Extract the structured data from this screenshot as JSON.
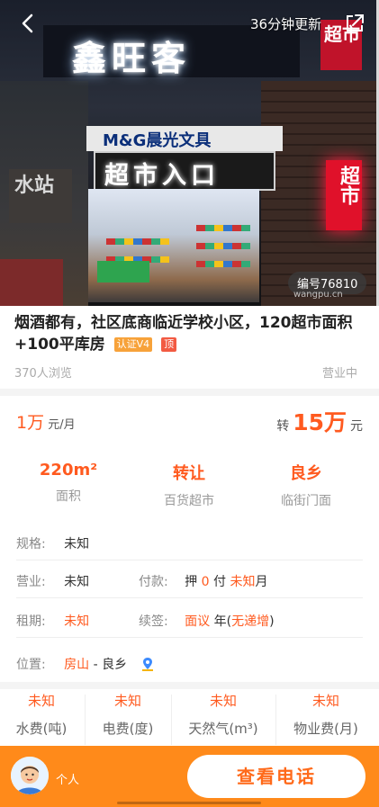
{
  "header": {
    "update_text": "36分钟更新",
    "code": "编号76810",
    "watermark": "wangpu.cn",
    "photo_signs": {
      "store_name": "鑫旺客",
      "brand": "M&G晨光文具",
      "entrance": "超市入口",
      "side_sign": "超市",
      "top_sign": "超市",
      "water": "水站"
    }
  },
  "listing": {
    "title": "烟酒都有，社区底商临近学校小区，120超市面积+100平库房",
    "tag_verified": "认证V4",
    "tag_top": "顶",
    "views": "370人浏览",
    "status": "营业中"
  },
  "price": {
    "rent_value": "1万",
    "rent_unit": "元/月",
    "transfer_label": "转",
    "transfer_value": "15万",
    "transfer_unit": "元"
  },
  "stats": [
    {
      "value": "220m²",
      "label": "面积"
    },
    {
      "value": "转让",
      "label": "百货超市"
    },
    {
      "value": "良乡",
      "label": "临街门面"
    }
  ],
  "details": {
    "spec_key": "规格:",
    "spec_val": "未知",
    "business_key": "营业:",
    "business_val": "未知",
    "pay_key": "付款:",
    "pay_prefix": "押",
    "pay_deposit": "0",
    "pay_mid": "付",
    "pay_months": "未知",
    "pay_suffix": "月",
    "lease_key": "租期:",
    "lease_val": "未知",
    "renew_key": "续签:",
    "renew_val": "面议",
    "renew_mid": "年(",
    "renew_inc": "无递增",
    "renew_end": ")",
    "location_key": "位置:",
    "location_district": "房山",
    "location_sep": "- 良乡"
  },
  "fees": [
    {
      "value": "未知",
      "label": "水费(吨)"
    },
    {
      "value": "未知",
      "label": "电费(度)"
    },
    {
      "value": "未知",
      "label": "天然气(m³)"
    },
    {
      "value": "未知",
      "label": "物业费(月)"
    }
  ],
  "footer": {
    "person_label": "个人",
    "call_label": "查看电话"
  },
  "colors": {
    "accent": "#ff5a1f",
    "bottom_bar": "#ff8a1a"
  }
}
